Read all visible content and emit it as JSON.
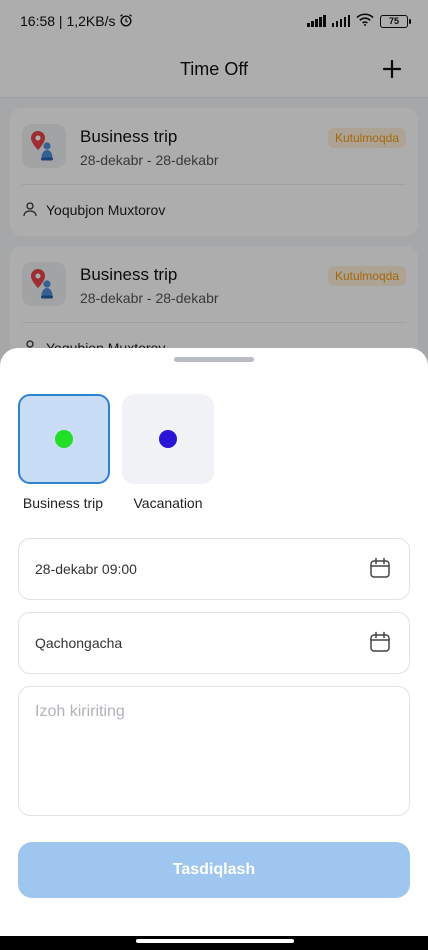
{
  "status": {
    "time_speed": "16:58 | 1,2KB/s",
    "battery": "75"
  },
  "header": {
    "title": "Time Off"
  },
  "requests": [
    {
      "title": "Business trip",
      "dates": "28-dekabr - 28-dekabr",
      "status": "Kutulmoqda",
      "person": "Yoqubjon Muxtorov"
    },
    {
      "title": "Business trip",
      "dates": "28-dekabr - 28-dekabr",
      "status": "Kutulmoqda",
      "person": "Yoqubjon Muxtorov"
    }
  ],
  "sheet": {
    "types": [
      {
        "label": "Business trip",
        "dot_color": "#22e02a",
        "selected": true
      },
      {
        "label": "Vacanation",
        "dot_color": "#2a14d6",
        "selected": false
      }
    ],
    "start_value": "28-dekabr 09:00",
    "end_value": "Qachongacha",
    "comment_placeholder": "Izoh kiririting",
    "submit_label": "Tasdiqlash"
  },
  "colors": {
    "accent": "#2f82d0",
    "badge_text": "#f09a12",
    "submit_bg": "#9ec6ee"
  }
}
